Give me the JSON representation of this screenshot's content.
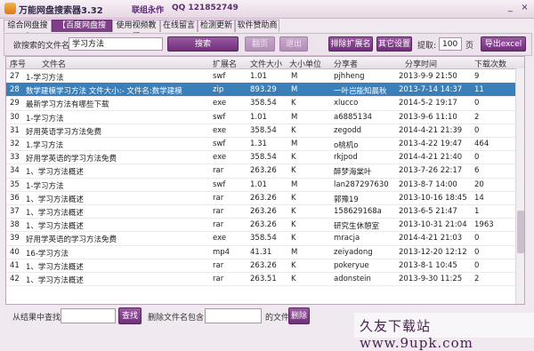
{
  "window": {
    "title": "万能网盘搜索器3.32",
    "author": "联组永作",
    "qq": "QQ 121852749",
    "minimize_icon": "_",
    "close_icon": "×"
  },
  "tabs": [
    {
      "label": "综合网盘搜索",
      "active": false
    },
    {
      "label": "【百度网盘搜索】",
      "active": true
    },
    {
      "label": "使用视频教程",
      "active": false
    },
    {
      "label": "在线留言",
      "active": false
    },
    {
      "label": "检测更新",
      "active": false
    },
    {
      "label": "软件赞助商",
      "active": false
    }
  ],
  "toolbar": {
    "search_label": "欲搜索的文件名:",
    "search_value": "学习方法",
    "search_btn": "搜索",
    "btn_disabled_1": "翻页",
    "btn_disabled_2": "退出",
    "exclude_ext_btn": "排除扩展名",
    "other_settings_btn": "其它设置",
    "extract_label": "提取:",
    "extract_value": "100",
    "page_label": "页",
    "export_btn": "导出excel"
  },
  "table": {
    "headers": [
      "序号",
      "文件名",
      "扩展名",
      "文件大小",
      "大小单位",
      "分享者",
      "分享时间",
      "下载次数"
    ],
    "rows": [
      {
        "no": "27",
        "name": "1-学习方法",
        "ext": "swf",
        "size": "1.01",
        "unit": "M",
        "sharer": "pjhheng",
        "time": "2013-9-9 21:50",
        "dl": "9"
      },
      {
        "no": "28",
        "name": "数学建模学习方法  文件大小:-  文件名:数学建模",
        "ext": "zip",
        "size": "893.29",
        "unit": "M",
        "sharer": "一叶岂能知晨秋",
        "time": "2013-7-14 14:37",
        "dl": "11",
        "selected": true
      },
      {
        "no": "29",
        "name": "最新学习方法有哪些下载",
        "ext": "exe",
        "size": "358.54",
        "unit": "K",
        "sharer": "xlucco",
        "time": "2014-5-2 19:17",
        "dl": "0"
      },
      {
        "no": "30",
        "name": "1-学习方法",
        "ext": "swf",
        "size": "1.01",
        "unit": "M",
        "sharer": "a6885134",
        "time": "2013-9-6 11:10",
        "dl": "2"
      },
      {
        "no": "31",
        "name": "好用英语学习方法免费",
        "ext": "exe",
        "size": "358.54",
        "unit": "K",
        "sharer": "zegodd",
        "time": "2014-4-21 21:39",
        "dl": "0"
      },
      {
        "no": "32",
        "name": "1.学习方法",
        "ext": "swf",
        "size": "1.31",
        "unit": "M",
        "sharer": "o桃机o",
        "time": "2013-4-22 19:47",
        "dl": "464"
      },
      {
        "no": "33",
        "name": "好用学英语的学习方法免费",
        "ext": "exe",
        "size": "358.54",
        "unit": "K",
        "sharer": "rkjpod",
        "time": "2014-4-21 21:40",
        "dl": "0"
      },
      {
        "no": "34",
        "name": "1、学习方法概述",
        "ext": "rar",
        "size": "263.26",
        "unit": "K",
        "sharer": "醉梦海棠叶",
        "time": "2013-7-26 22:17",
        "dl": "6"
      },
      {
        "no": "35",
        "name": "1-学习方法",
        "ext": "swf",
        "size": "1.01",
        "unit": "M",
        "sharer": "lan287297630",
        "time": "2013-8-7 14:00",
        "dl": "20"
      },
      {
        "no": "36",
        "name": "1、学习方法概述",
        "ext": "rar",
        "size": "263.26",
        "unit": "K",
        "sharer": "郭豫19",
        "time": "2013-10-16 18:45",
        "dl": "14"
      },
      {
        "no": "37",
        "name": "1、学习方法概述",
        "ext": "rar",
        "size": "263.26",
        "unit": "K",
        "sharer": "158629168a",
        "time": "2013-6-5 21:47",
        "dl": "1"
      },
      {
        "no": "38",
        "name": "1、学习方法概述",
        "ext": "rar",
        "size": "263.26",
        "unit": "K",
        "sharer": "研究生休憩室",
        "time": "2013-10-31 21:04",
        "dl": "1963"
      },
      {
        "no": "39",
        "name": "好用学英语的学习方法免费",
        "ext": "exe",
        "size": "358.54",
        "unit": "K",
        "sharer": "mracja",
        "time": "2014-4-21 21:03",
        "dl": "0"
      },
      {
        "no": "40",
        "name": "16-学习方法",
        "ext": "mp4",
        "size": "41.31",
        "unit": "M",
        "sharer": "zeiyadong",
        "time": "2013-12-20 12:12",
        "dl": "0"
      },
      {
        "no": "41",
        "name": "1、学习方法概述",
        "ext": "rar",
        "size": "263.26",
        "unit": "K",
        "sharer": "pokeryue",
        "time": "2013-8-1 10:45",
        "dl": "0"
      },
      {
        "no": "42",
        "name": "1、学习方法概述",
        "ext": "rar",
        "size": "263.51",
        "unit": "K",
        "sharer": "adonstein",
        "time": "2013-9-30 11:25",
        "dl": "2"
      }
    ]
  },
  "bottom": {
    "find_label": "从结果中查找:",
    "find_btn": "查找",
    "delete_label": "删除文件名包含:",
    "file_suffix": "的文件",
    "delete_btn": "删除"
  },
  "watermark": {
    "text": "久友下载站 www.9upk.com"
  }
}
